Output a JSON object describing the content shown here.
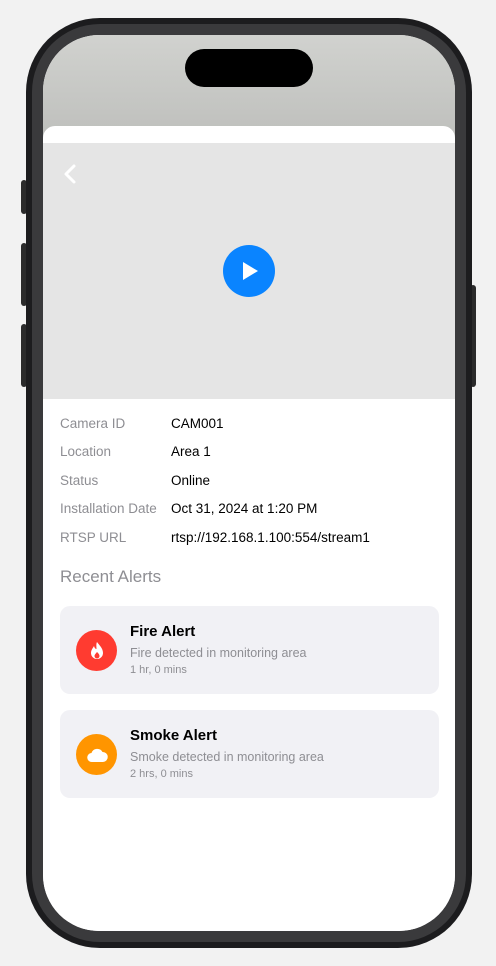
{
  "camera": {
    "back_icon": "chevron-left-icon",
    "play_icon": "play-icon"
  },
  "info": [
    {
      "label": "Camera ID",
      "value": "CAM001"
    },
    {
      "label": "Location",
      "value": "Area 1"
    },
    {
      "label": "Status",
      "value": "Online"
    },
    {
      "label": "Installation Date",
      "value": "Oct 31, 2024 at 1:20 PM"
    },
    {
      "label": "RTSP URL",
      "value": "rtsp://192.168.1.100:554/stream1"
    }
  ],
  "alerts_section": {
    "title": "Recent Alerts"
  },
  "alerts": [
    {
      "title": "Fire Alert",
      "description": "Fire detected in monitoring area",
      "time": "1 hr, 0 mins",
      "icon": "flame-icon",
      "color": "#ff3b30"
    },
    {
      "title": "Smoke Alert",
      "description": "Smoke detected in monitoring area",
      "time": "2 hrs, 0 mins",
      "icon": "cloud-icon",
      "color": "#ff9500"
    }
  ],
  "colors": {
    "accent": "#0a84ff",
    "fire": "#ff3b30",
    "smoke": "#ff9500"
  }
}
